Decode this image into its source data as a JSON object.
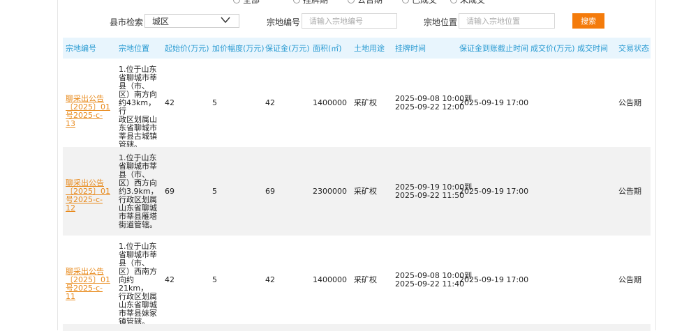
{
  "filters": {
    "radio_options": [
      "全部",
      "挂牌期",
      "公告期",
      "已成交",
      "未成交"
    ]
  },
  "search": {
    "county_label": "县市检索",
    "county_value": "城区",
    "code_label": "宗地编号",
    "code_placeholder": "请输入宗地编号",
    "location_label": "宗地位置",
    "location_placeholder": "请输入宗地位置",
    "button_label": "搜索"
  },
  "table": {
    "headers": [
      "宗地编号",
      "宗地位置",
      "起始价(万元)",
      "加价幅度(万元)",
      "保证金(万元)",
      "面积(㎡)",
      "土地用途",
      "挂牌时间",
      "保证金到账截止时间",
      "成交价(万元)",
      "成交时间",
      "交易状态"
    ],
    "rows": [
      {
        "code": "聊采出公告〔2025〕01号2025-c-13",
        "location": "1.位于山东\n省聊城市莘\n县（市、\n区）南方向\n约43km，行\n政区划属山\n东省聊城市\n莘县古城镇\n管辖。",
        "start_price": "42",
        "increment": "5",
        "deposit": "42",
        "area": "1400000",
        "usage": "采矿权",
        "listing_start": "2025-09-08 10:00到",
        "listing_end": "2025-09-22 12:00",
        "deposit_deadline": "2025-09-19 17:00",
        "deal_price": "",
        "deal_time": "",
        "status": "公告期"
      },
      {
        "code": "聊采出公告〔2025〕01号2025-c-12",
        "location": "1.位于山东\n省聊城市莘\n县（市、\n区）西方向\n约3.9km，\n行政区划属\n山东省聊城\n市莘县雁塔\n街道管辖。",
        "start_price": "69",
        "increment": "5",
        "deposit": "69",
        "area": "2300000",
        "usage": "采矿权",
        "listing_start": "2025-09-19 10:00到",
        "listing_end": "2025-09-22 11:50",
        "deposit_deadline": "2025-09-19 17:00",
        "deal_price": "",
        "deal_time": "",
        "status": "公告期"
      },
      {
        "code": "聊采出公告〔2025〕01号2025-c-11",
        "location": "1.位于山东\n省聊城市莘\n县（市、\n区）西南方\n向约21km，\n行政区划属\n山东省聊城\n市莘县妹冢\n镇管辖。",
        "start_price": "42",
        "increment": "5",
        "deposit": "42",
        "area": "1400000",
        "usage": "采矿权",
        "listing_start": "2025-09-08 10:00到",
        "listing_end": "2025-09-22 11:40",
        "deposit_deadline": "2025-09-19 17:00",
        "deal_price": "",
        "deal_time": "",
        "status": "公告期"
      }
    ]
  },
  "colors": {
    "accent": "#f47b0b",
    "header_bg": "#e8f5fd",
    "header_text": "#2a9bd2",
    "link": "#e8891a",
    "alt_row": "#f2f2f2"
  }
}
